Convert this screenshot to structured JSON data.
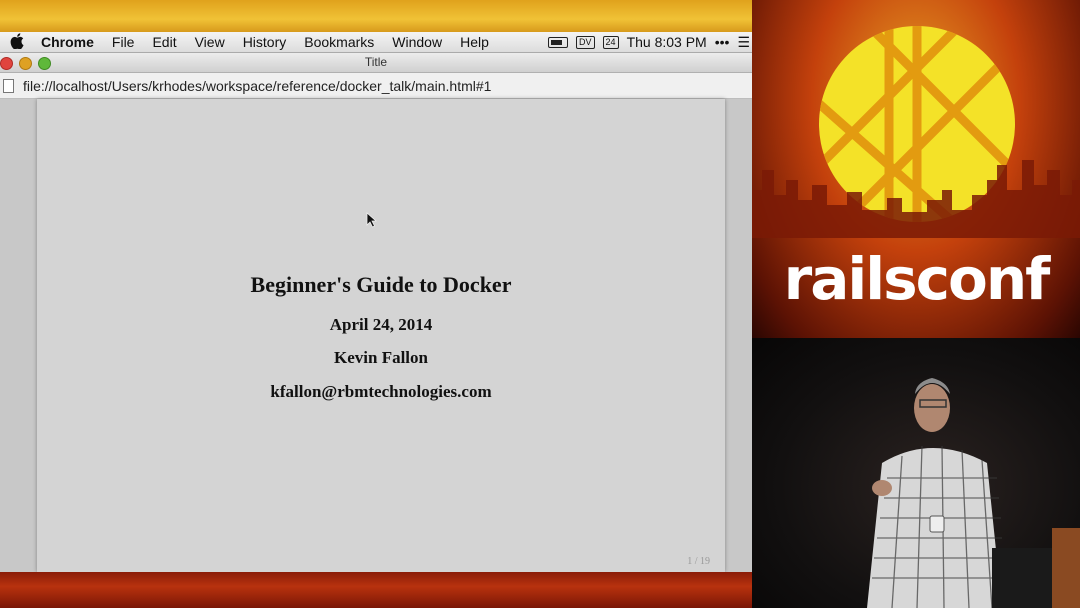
{
  "menubar": {
    "app_name": "Chrome",
    "items": [
      "File",
      "Edit",
      "View",
      "History",
      "Bookmarks",
      "Window",
      "Help"
    ],
    "tray_badge": "DV",
    "calendar_day": "24",
    "clock": "Thu 8:03 PM",
    "more": "•••",
    "list_icon": "☰"
  },
  "window": {
    "title": "Title",
    "url": "file://localhost/Users/krhodes/workspace/reference/docker_talk/main.html#1"
  },
  "slide": {
    "title": "Beginner's Guide to Docker",
    "date": "April 24, 2014",
    "author": "Kevin Fallon",
    "email": "kfallon@rbmtechnologies.com",
    "page_indicator": "1 / 19"
  },
  "branding": {
    "logo_text": "railsconf",
    "sun_color": "#f4e228",
    "accent_orange": "#c4410c"
  }
}
